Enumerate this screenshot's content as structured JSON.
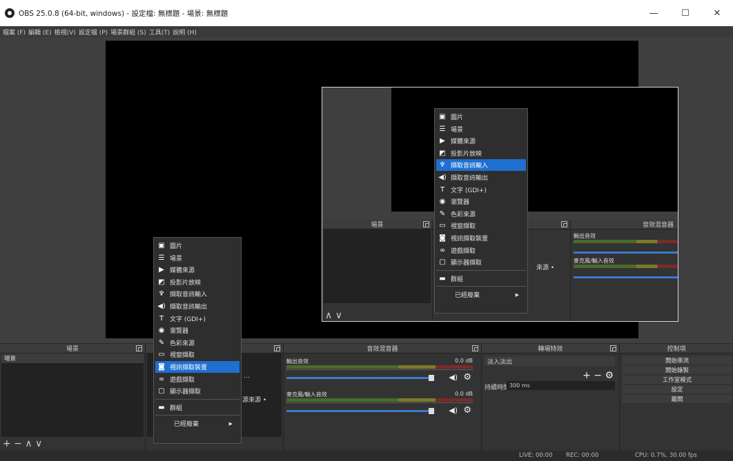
{
  "window": {
    "title": "OBS 25.0.8 (64-bit, windows) - 設定檔: 無標題 - 場景: 無標題",
    "minimize": "—",
    "maximize": "☐",
    "close": "✕"
  },
  "menu": [
    "檔案 (F)",
    "編輯 (E)",
    "檢視(V)",
    "設定檔 (P)",
    "場景群組 (S)",
    "工具(T)",
    "說明 (H)"
  ],
  "docks": {
    "scenes": {
      "title": "場景",
      "items": [
        "場景"
      ],
      "toolbar": "+ − ∧ ∨"
    },
    "sources": {
      "partial_text_1": "…",
      "partial_text_2": "源來源 •"
    },
    "mixer": {
      "title": "音效混音器",
      "channels": [
        {
          "name": "輸出音效",
          "db": "0.0 dB"
        },
        {
          "name": "麥克風/輸入音效",
          "db": "0.0 dB"
        }
      ]
    },
    "transitions": {
      "title": "轉場特效",
      "selected": "淡入淡出",
      "tools": "+ − ⚙",
      "duration_label": "持續時間",
      "duration_value": "300 ms"
    },
    "controls": {
      "title": "控制項",
      "buttons": [
        "開始串流",
        "開始錄製",
        "工作室模式",
        "設定",
        "離開"
      ]
    }
  },
  "status": {
    "live": "LIVE: 00:00",
    "rec": "REC: 00:00",
    "cpu": "CPU: 0.7%, 30.00 fps"
  },
  "context_menu": {
    "items": [
      {
        "label": "圖片",
        "icon": "image-icon"
      },
      {
        "label": "場景",
        "icon": "list-icon"
      },
      {
        "label": "媒體來源",
        "icon": "play-icon"
      },
      {
        "label": "投影片放映",
        "icon": "slideshow-icon"
      },
      {
        "label": "擷取音訊輸入",
        "icon": "microphone-icon"
      },
      {
        "label": "擷取音訊輸出",
        "icon": "speaker-icon"
      },
      {
        "label": "文字 (GDI+)",
        "icon": "text-icon"
      },
      {
        "label": "瀏覽器",
        "icon": "globe-icon"
      },
      {
        "label": "色彩來源",
        "icon": "brush-icon"
      },
      {
        "label": "視窗擷取",
        "icon": "window-icon"
      },
      {
        "label": "視訊擷取裝置",
        "icon": "camera-icon"
      },
      {
        "label": "遊戲擷取",
        "icon": "gamepad-icon"
      },
      {
        "label": "顯示器擷取",
        "icon": "monitor-icon"
      },
      {
        "label": "群組",
        "icon": "folder-icon"
      },
      {
        "label": "已經廢棄",
        "icon": ""
      }
    ],
    "main_highlight": "視訊擷取裝置",
    "inset_highlight": "擷取音訊輸入"
  },
  "inset": {
    "scenes_title": "場景",
    "mixer_title": "音效混音器",
    "mixer_channels": [
      "輸出音效",
      "麥克風/輸入音效"
    ],
    "source_partial": "來源 •",
    "toolbar": "∧ ∨"
  }
}
